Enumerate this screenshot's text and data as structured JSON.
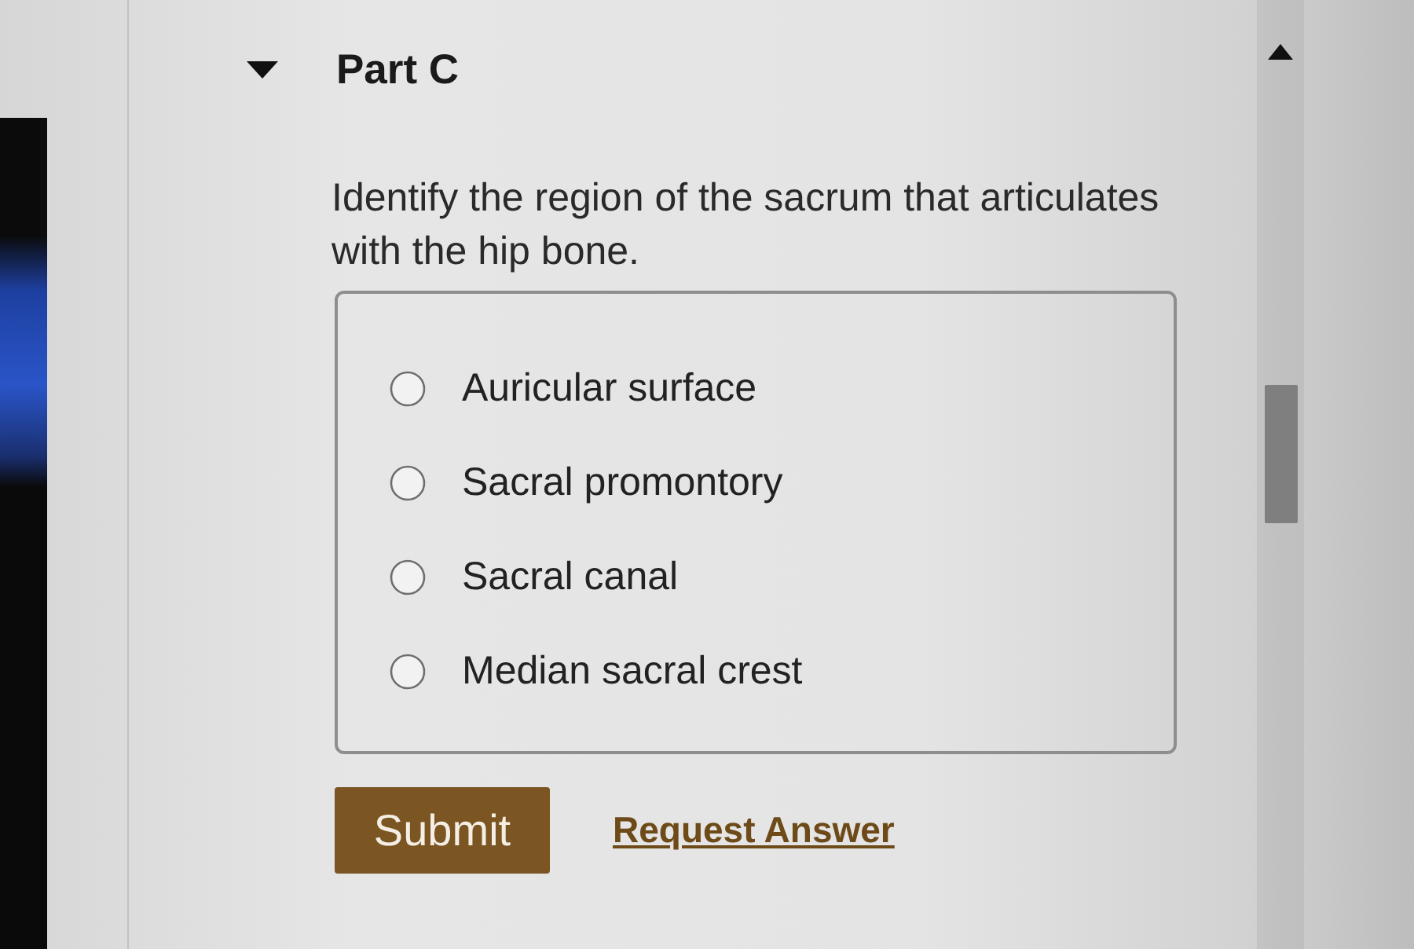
{
  "part": {
    "title": "Part C",
    "expanded": true
  },
  "question": "Identify the region of the sacrum that articulates with the hip bone.",
  "options": [
    {
      "label": "Auricular surface",
      "selected": false
    },
    {
      "label": "Sacral promontory",
      "selected": false
    },
    {
      "label": "Sacral canal",
      "selected": false
    },
    {
      "label": "Median sacral crest",
      "selected": false
    }
  ],
  "actions": {
    "submit": "Submit",
    "request_answer": "Request Answer"
  }
}
